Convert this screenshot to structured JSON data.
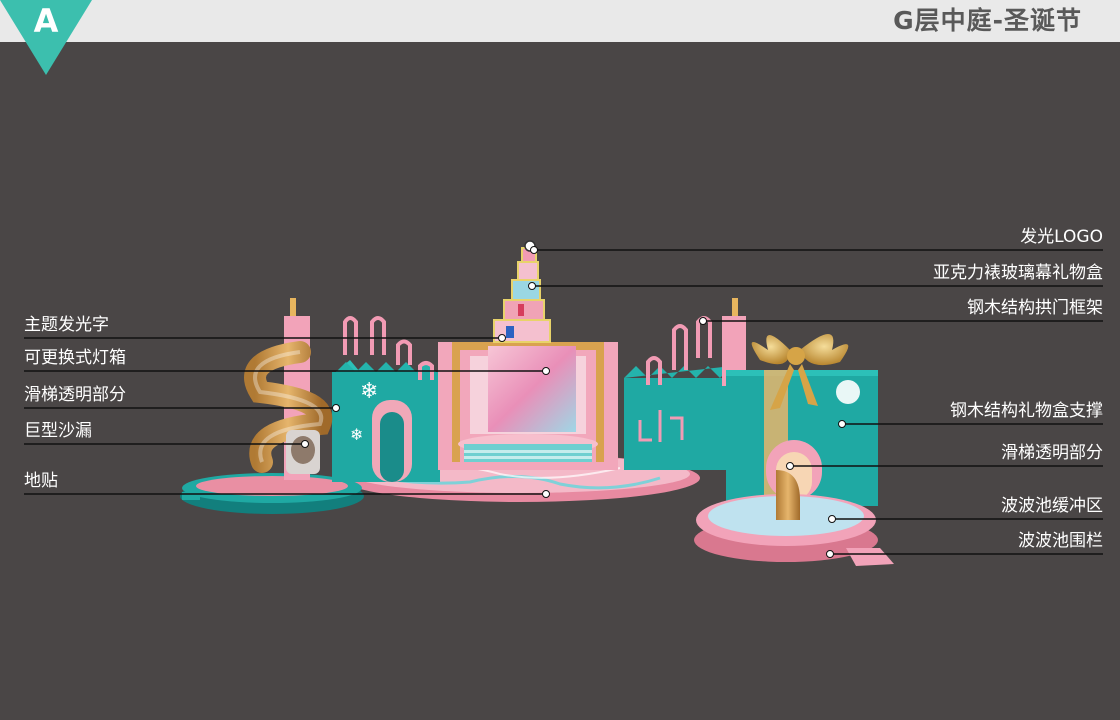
{
  "header": {
    "badge_letter": "A",
    "title": "G层中庭-圣诞节"
  },
  "labels_left": [
    "主题发光字",
    "可更换式灯箱",
    "滑梯透明部分",
    "巨型沙漏",
    "地贴"
  ],
  "labels_right": [
    "发光LOGO",
    "亚克力裱玻璃幕礼物盒",
    "钢木结构拱门框架",
    "钢木结构礼物盒支撑",
    "滑梯透明部分",
    "波波池缓冲区",
    "波波池围栏"
  ],
  "colors": {
    "background": "#4a4646",
    "header_bar": "#e9e9e9",
    "badge": "#3cbfae",
    "teal": "#1fa9a3",
    "pink": "#e98fa3",
    "gold": "#c9973f"
  }
}
